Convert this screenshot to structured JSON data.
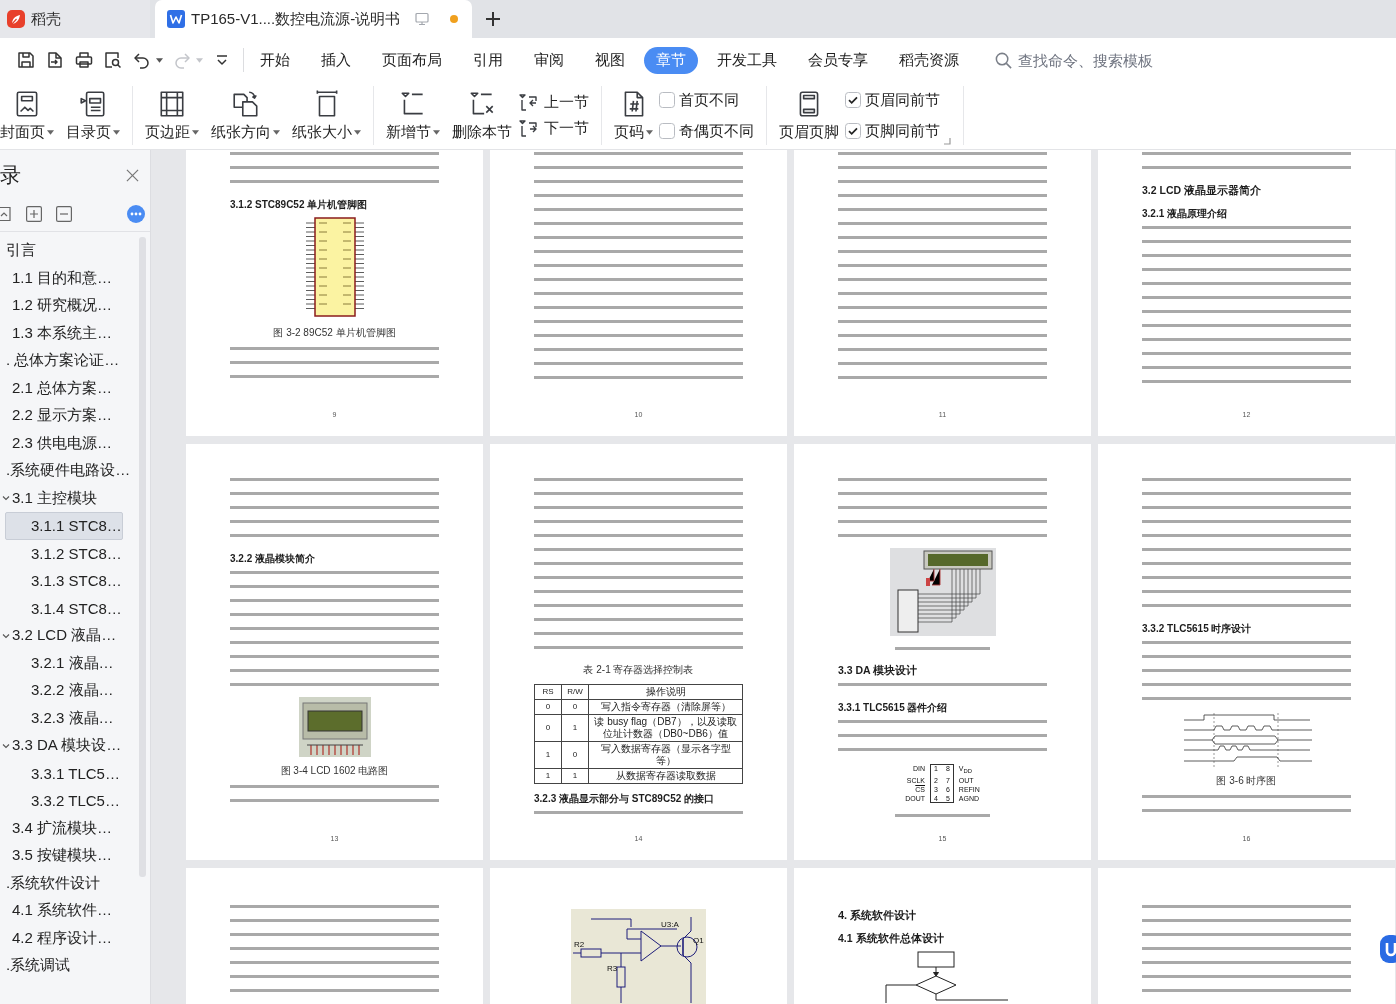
{
  "app_tabs": [
    {
      "kind": "home",
      "label": "稻壳",
      "selected": false
    },
    {
      "kind": "document",
      "label": "TP165-V1....数控电流源-说明书",
      "selected": true,
      "unsaved": true
    }
  ],
  "quick_tools": [
    {
      "kind": "save",
      "disabled": false
    },
    {
      "kind": "export",
      "disabled": false
    },
    {
      "kind": "print",
      "disabled": false
    },
    {
      "kind": "preview",
      "disabled": false
    },
    {
      "kind": "undo",
      "disabled": false,
      "dropdown": true
    },
    {
      "kind": "redo",
      "disabled": true,
      "dropdown": true
    },
    {
      "kind": "customize",
      "disabled": false
    }
  ],
  "menu_tabs": [
    {
      "label": "开始",
      "selected": false
    },
    {
      "label": "插入",
      "selected": false
    },
    {
      "label": "页面布局",
      "selected": false
    },
    {
      "label": "引用",
      "selected": false
    },
    {
      "label": "审阅",
      "selected": false
    },
    {
      "label": "视图",
      "selected": false
    },
    {
      "label": "章节",
      "selected": true
    },
    {
      "label": "开发工具",
      "selected": false
    },
    {
      "label": "会员专享",
      "selected": false
    },
    {
      "label": "稻壳资源",
      "selected": false
    }
  ],
  "search": {
    "placeholder": "查找命令、搜索模板"
  },
  "ribbon": {
    "groups": [
      {
        "items": [
          {
            "kind": "cover",
            "label": "封面页",
            "dropdown": true
          },
          {
            "kind": "toc",
            "label": "目录页",
            "dropdown": true
          }
        ]
      },
      {
        "items": [
          {
            "kind": "margins",
            "label": "页边距",
            "dropdown": true
          },
          {
            "kind": "orientation",
            "label": "纸张方向",
            "dropdown": true
          },
          {
            "kind": "papersize",
            "label": "纸张大小",
            "dropdown": true
          }
        ]
      },
      {
        "items": [
          {
            "kind": "newsection",
            "label": "新增节",
            "dropdown": true
          },
          {
            "kind": "deletesection",
            "label": "删除本节",
            "dropdown": false
          },
          {
            "kind": "sectionnav",
            "buttons": [
              {
                "kind": "previous",
                "label": "上一节"
              },
              {
                "kind": "next",
                "label": "下一节"
              }
            ]
          }
        ]
      },
      {
        "items": [
          {
            "kind": "pagenumber",
            "label": "页码",
            "dropdown": true
          },
          {
            "kind": "checks",
            "options": [
              {
                "label": "首页不同",
                "checked": false
              },
              {
                "label": "奇偶页不同",
                "checked": false
              }
            ]
          }
        ]
      },
      {
        "items": [
          {
            "kind": "headerfooter",
            "label": "页眉页脚",
            "dropdown": false
          },
          {
            "kind": "checks",
            "options": [
              {
                "label": "页眉同前节",
                "checked": true
              },
              {
                "label": "页脚同前节",
                "checked": true
              }
            ]
          }
        ]
      }
    ]
  },
  "sidebar": {
    "title": "录",
    "items": [
      {
        "label": "引言",
        "selected": false,
        "children": [
          {
            "label": "1.1  目的和意…",
            "selected": false
          },
          {
            "label": "1.2 研究概况…",
            "selected": false
          },
          {
            "label": "1.3  本系统主…",
            "selected": false
          }
        ]
      },
      {
        "label": ". 总体方案论证…",
        "selected": false,
        "children": [
          {
            "label": "2.1 总体方案…",
            "selected": false
          },
          {
            "label": "2.2 显示方案…",
            "selected": false
          },
          {
            "label": "2.3 供电电源…",
            "selected": false
          }
        ]
      },
      {
        "label": ".系统硬件电路设…",
        "selected": false,
        "children": [
          {
            "label": "3.1 主控模块",
            "selected": false,
            "expanded": true,
            "children": [
              {
                "label": "3.1.1 STC8…",
                "selected": true
              },
              {
                "label": "3.1.2 STC8…",
                "selected": false
              },
              {
                "label": "3.1.3 STC8…",
                "selected": false
              },
              {
                "label": "3.1.4 STC8…",
                "selected": false
              }
            ]
          },
          {
            "label": "3.2 LCD 液晶…",
            "selected": false,
            "expanded": true,
            "children": [
              {
                "label": "3.2.1  液晶…",
                "selected": false
              },
              {
                "label": "3.2.2 液晶…",
                "selected": false
              },
              {
                "label": "3.2.3 液晶…",
                "selected": false
              }
            ]
          },
          {
            "label": "3.3 DA 模块设…",
            "selected": false,
            "expanded": true,
            "children": [
              {
                "label": "3.3.1 TLC5…",
                "selected": false
              },
              {
                "label": "3.3.2 TLC5…",
                "selected": false
              }
            ]
          },
          {
            "label": "3.4 扩流模块…",
            "selected": false
          },
          {
            "label": "3.5 按键模块…",
            "selected": false
          }
        ]
      },
      {
        "label": ".系统软件设计",
        "selected": false,
        "children": [
          {
            "label": "4.1 系统软件…",
            "selected": false
          },
          {
            "label": "4.2 程序设计…",
            "selected": false
          }
        ]
      },
      {
        "label": ".系统调试",
        "selected": false
      }
    ]
  },
  "pages": [
    {
      "blocks": [
        {
          "kind": "text"
        },
        {
          "kind": "subheading",
          "text": "3.1.2 STC89C52 单片机管脚图"
        },
        {
          "kind": "chip"
        },
        {
          "kind": "caption",
          "text": "图 3-2 89C52 单片机管脚图"
        },
        {
          "kind": "text"
        }
      ],
      "number": "9"
    },
    {
      "blocks": [
        {
          "kind": "text"
        }
      ],
      "number": "10"
    },
    {
      "blocks": [
        {
          "kind": "text"
        }
      ],
      "number": "11"
    },
    {
      "blocks": [
        {
          "kind": "text"
        },
        {
          "kind": "heading",
          "text": "3.2 LCD 液晶显示器简介"
        },
        {
          "kind": "subheading",
          "text": "3.2.1 液晶原理介绍"
        },
        {
          "kind": "text"
        }
      ],
      "number": "12"
    },
    {
      "blocks": [
        {
          "kind": "text"
        },
        {
          "kind": "subheading",
          "text": "3.2.2 液晶模块简介"
        },
        {
          "kind": "text"
        },
        {
          "kind": "lcdmodule"
        },
        {
          "kind": "caption",
          "text": "图 3-4 LCD 1602 电路图"
        },
        {
          "kind": "text"
        }
      ],
      "number": "13"
    },
    {
      "blocks": [
        {
          "kind": "text"
        },
        {
          "kind": "caption",
          "text": "表 2-1 寄存器选择控制表"
        },
        {
          "kind": "table",
          "columns": [
            "RS",
            "R/W",
            "操作说明"
          ],
          "rows": [
            [
              "0",
              "0",
              "写入指令寄存器（清除屏等）"
            ],
            [
              "0",
              "1",
              "读 busy flag（DB7），以及读取位址计数器（DB0~DB6）值"
            ],
            [
              "1",
              "0",
              "写入数据寄存器（显示各字型等）"
            ],
            [
              "1",
              "1",
              "从数据寄存器读取数据"
            ]
          ]
        },
        {
          "kind": "subheading",
          "text": "3.2.3 液晶显示部分与 STC89C52 的接口"
        },
        {
          "kind": "text"
        }
      ],
      "number": "14"
    },
    {
      "blocks": [
        {
          "kind": "text"
        },
        {
          "kind": "lcdcircuit"
        },
        {
          "kind": "captionline"
        },
        {
          "kind": "heading",
          "text": "3.3 DA 模块设计"
        },
        {
          "kind": "text"
        },
        {
          "kind": "subheading",
          "text": "3.3.1 TLC5615 器件介绍"
        },
        {
          "kind": "text"
        },
        {
          "kind": "pinout",
          "pins": [
            {
              "name": "DIN",
              "number": "1",
              "active_low": false
            },
            {
              "number": "8",
              "name": "V$_{DD}$",
              "active_low": false
            },
            {
              "name": "SCLK",
              "number": "2",
              "active_low": false
            },
            {
              "number": "7",
              "name": "OUT",
              "active_low": false
            },
            {
              "name": "CS",
              "number": "3",
              "active_low": true
            },
            {
              "number": "6",
              "name": "REFIN",
              "active_low": false
            },
            {
              "name": "DOUT",
              "number": "4",
              "active_low": false
            },
            {
              "number": "5",
              "name": "AGND",
              "active_low": false
            }
          ]
        },
        {
          "kind": "captionline"
        }
      ],
      "number": "15"
    },
    {
      "blocks": [
        {
          "kind": "text"
        },
        {
          "kind": "subheading",
          "text": "3.3.2 TLC5615 时序设计"
        },
        {
          "kind": "text"
        },
        {
          "kind": "timing"
        },
        {
          "kind": "caption",
          "text": "图 3-6 时序图"
        },
        {
          "kind": "text"
        }
      ],
      "number": "16"
    },
    {
      "blocks": [
        {
          "kind": "text"
        }
      ]
    },
    {
      "blocks": [
        {
          "kind": "circuit",
          "labels": [
            "R2",
            "R3",
            "U3:A",
            "Q1"
          ]
        }
      ]
    },
    {
      "blocks": [
        {
          "kind": "chapter",
          "text": "4. 系统软件设计"
        },
        {
          "kind": "heading",
          "text": "4.1 系统软件总体设计"
        },
        {
          "kind": "flowchart"
        }
      ]
    },
    {
      "blocks": [
        {
          "kind": "text"
        }
      ]
    }
  ]
}
